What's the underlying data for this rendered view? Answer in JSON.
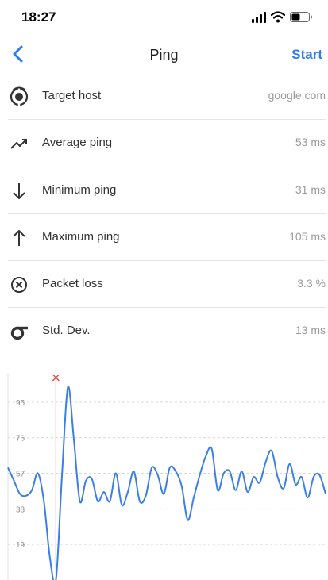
{
  "status_bar": {
    "time": "18:27",
    "icons": [
      "signal-icon",
      "wifi-icon",
      "battery-icon"
    ]
  },
  "nav": {
    "back_icon": "chevron-left-icon",
    "title": "Ping",
    "start_label": "Start",
    "accent_color": "#2f7bf0"
  },
  "stats": [
    {
      "icon": "target-host-icon",
      "label": "Target host",
      "value": "google.com"
    },
    {
      "icon": "trending-up-icon",
      "label": "Average ping",
      "value": "53 ms"
    },
    {
      "icon": "arrow-down-icon",
      "label": "Minimum ping",
      "value": "31 ms"
    },
    {
      "icon": "arrow-up-icon",
      "label": "Maximum ping",
      "value": "105 ms"
    },
    {
      "icon": "close-circle-icon",
      "label": "Packet loss",
      "value": "3.3 %"
    },
    {
      "icon": "sigma-icon",
      "label": "Std. Dev.",
      "value": "13 ms"
    }
  ],
  "chart_data": {
    "type": "line",
    "title": "",
    "xlabel": "",
    "ylabel": "",
    "ylim": [
      0,
      114
    ],
    "y_ticks": [
      "19",
      "38",
      "57",
      "76",
      "95"
    ],
    "grid": true,
    "line_color": "#3a7ee8",
    "marker_color": "#e04a4a",
    "marker_index": 8,
    "x": [
      0,
      1,
      2,
      3,
      4,
      5,
      6,
      7,
      8,
      9,
      10,
      11,
      12,
      13,
      14,
      15,
      16,
      17,
      18,
      19,
      20,
      21,
      22,
      23,
      24,
      25,
      26,
      27,
      28,
      29,
      30,
      31,
      32,
      33,
      34,
      35,
      36,
      37,
      38,
      39,
      40,
      41,
      42,
      43,
      44,
      45,
      46,
      47,
      48,
      49,
      50,
      51,
      52,
      53
    ],
    "values": [
      60,
      53,
      46,
      45,
      48,
      57,
      42,
      12,
      0,
      55,
      103,
      75,
      42,
      53,
      54,
      42,
      47,
      42,
      57,
      40,
      47,
      58,
      42,
      45,
      60,
      56,
      46,
      60,
      58,
      50,
      32,
      44,
      56,
      66,
      70,
      48,
      57,
      58,
      48,
      58,
      47,
      55,
      52,
      63,
      69,
      55,
      49,
      62,
      51,
      55,
      44,
      55,
      56,
      46
    ]
  }
}
